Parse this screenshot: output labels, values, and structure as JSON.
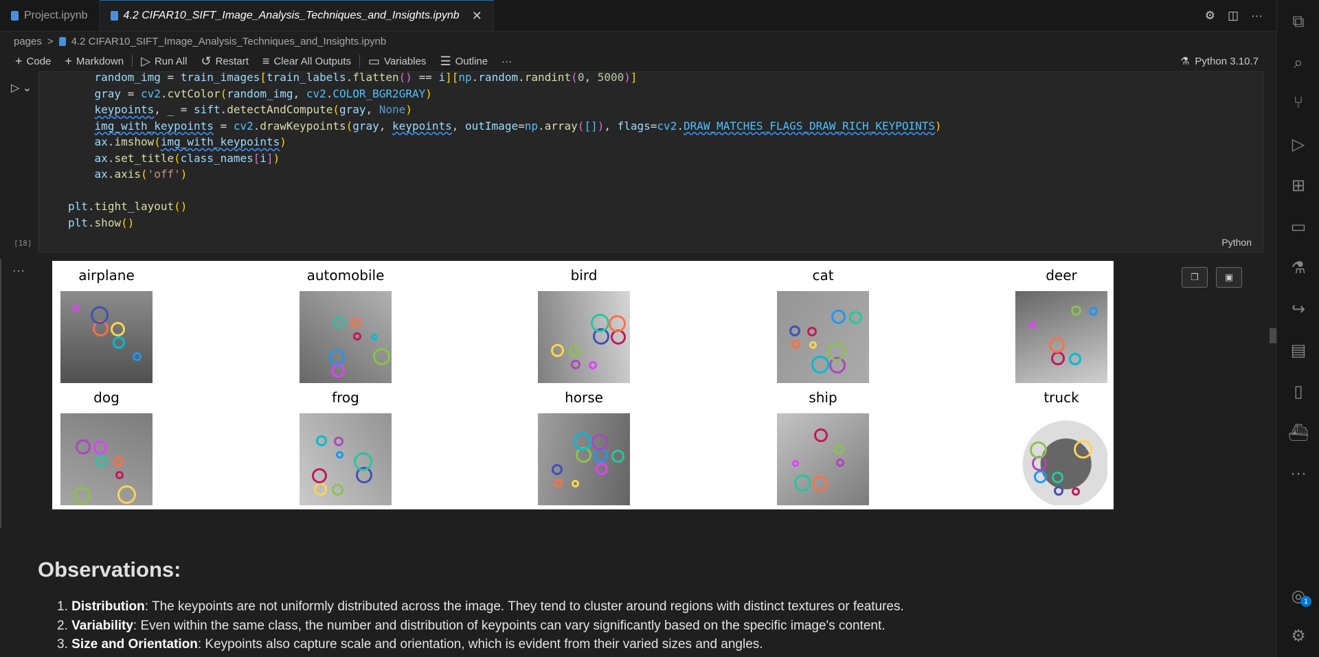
{
  "tabs": [
    {
      "label": "Project.ipynb",
      "active": false
    },
    {
      "label": "4.2 CIFAR10_SIFT_Image_Analysis_Techniques_and_Insights.ipynb",
      "active": true
    }
  ],
  "tab_actions": {
    "settings_icon": "gear-icon",
    "split_icon": "split-editor-icon",
    "more_icon": "more-icon"
  },
  "breadcrumb": {
    "folder": "pages",
    "separator": ">",
    "file": "4.2 CIFAR10_SIFT_Image_Analysis_Techniques_and_Insights.ipynb"
  },
  "toolbar": {
    "code": "Code",
    "markdown": "Markdown",
    "run_all": "Run All",
    "restart": "Restart",
    "clear_all": "Clear All Outputs",
    "variables": "Variables",
    "outline": "Outline",
    "more": "···",
    "kernel": "Python 3.10.7"
  },
  "cell": {
    "execution_count": "[18]",
    "language": "Python",
    "lines": [
      "    random_img = train_images[train_labels.flatten() == i][np.random.randint(0, 5000)]",
      "    gray = cv2.cvtColor(random_img, cv2.COLOR_BGR2GRAY)",
      "    keypoints, _ = sift.detectAndCompute(gray, None)",
      "    img_with_keypoints = cv2.drawKeypoints(gray, keypoints, outImage=np.array([]), flags=cv2.DRAW_MATCHES_FLAGS_DRAW_RICH_KEYPOINTS)",
      "    ax.imshow(img_with_keypoints)",
      "    ax.set_title(class_names[i])",
      "    ax.axis('off')",
      "",
      "plt.tight_layout()",
      "plt.show()"
    ]
  },
  "output": {
    "dots": "···",
    "titles": [
      "airplane",
      "automobile",
      "bird",
      "cat",
      "deer",
      "dog",
      "frog",
      "horse",
      "ship",
      "truck"
    ],
    "copy_icon": "copy-icon",
    "save_icon": "save-icon"
  },
  "markdown": {
    "heading": "Observations:",
    "items": [
      {
        "num": "1.",
        "term": "Distribution",
        "text": ": The keypoints are not uniformly distributed across the image. They tend to cluster around regions with distinct textures or features."
      },
      {
        "num": "2.",
        "term": "Variability",
        "text": ": Even within the same class, the number and distribution of keypoints can vary significantly based on the specific image's content."
      },
      {
        "num": "3.",
        "term": "Size and Orientation",
        "text": ": Keypoints also capture scale and orientation, which is evident from their varied sizes and angles."
      }
    ]
  },
  "activity_bar": [
    "explorer-icon",
    "search-icon",
    "source-control-icon",
    "run-debug-icon",
    "extensions-icon",
    "remote-explorer-icon",
    "testing-icon",
    "live-share-icon",
    "panel-icon",
    "jupyter-icon",
    "docker-icon",
    "more-icon",
    "account-icon",
    "manage-gear-icon"
  ],
  "account_badge": "1",
  "colors": {
    "accent": "#0078d4",
    "editor_bg": "#1f1f1f",
    "cell_bg": "#262626"
  }
}
